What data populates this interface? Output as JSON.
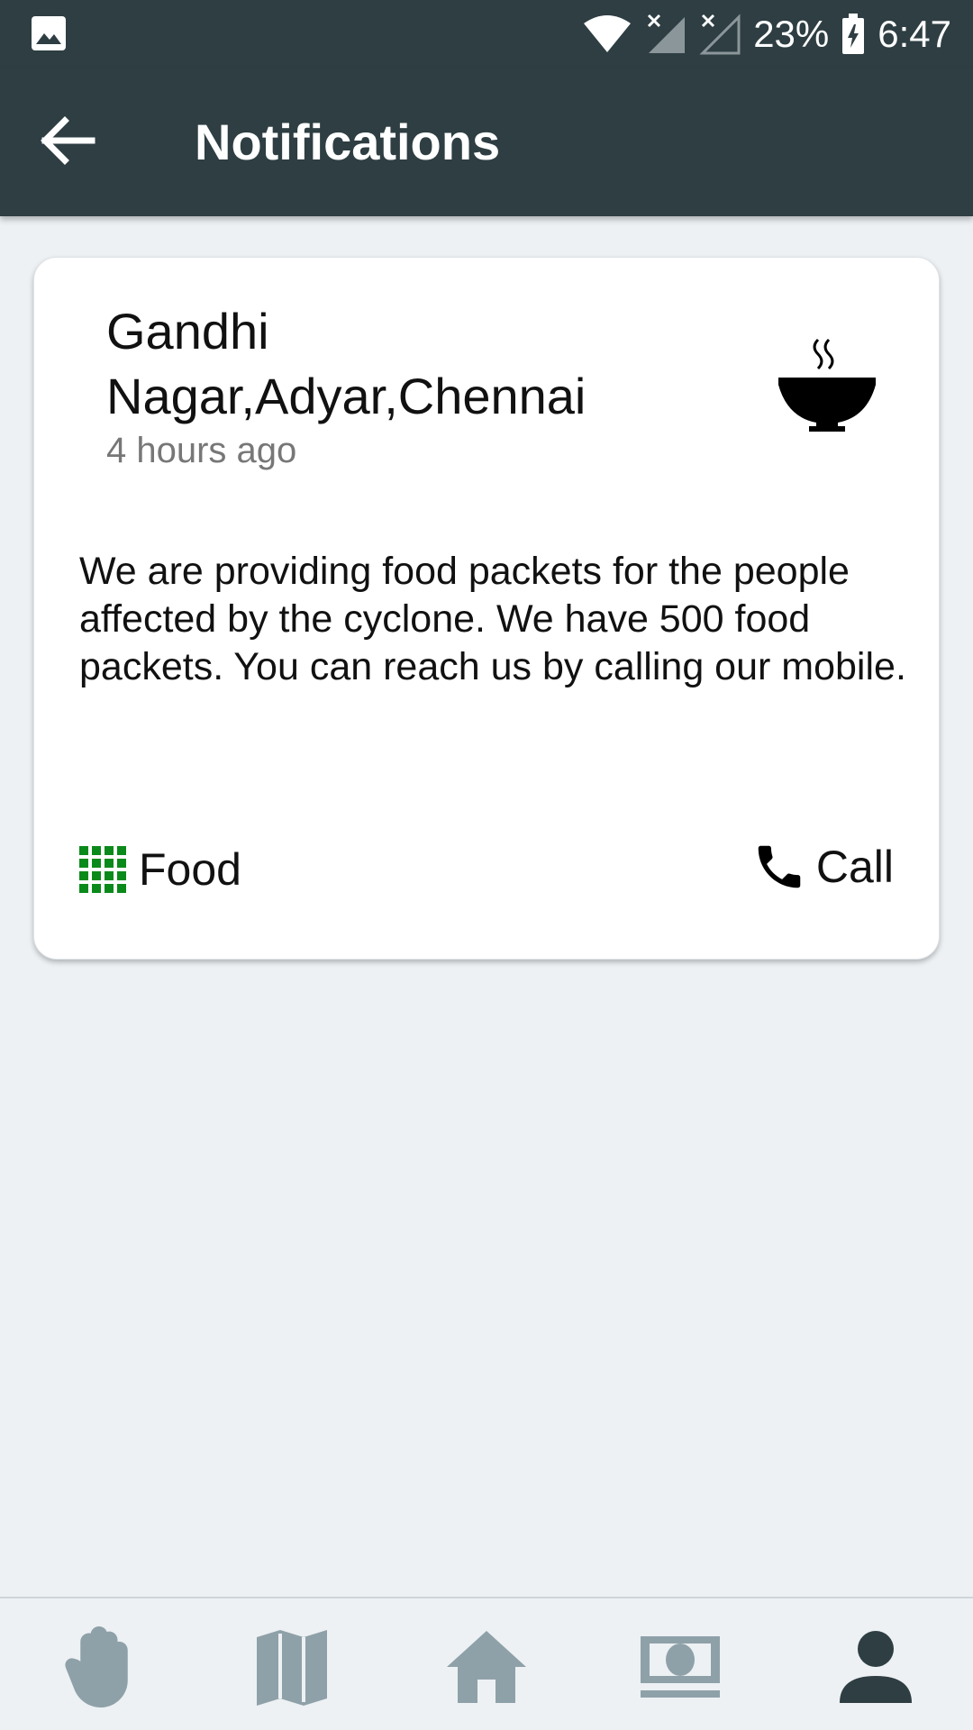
{
  "status_bar": {
    "battery": "23%",
    "time": "6:47"
  },
  "app_bar": {
    "title": "Notifications"
  },
  "notification": {
    "location": "Gandhi Nagar,Adyar,Chennai",
    "time_ago": "4 hours ago",
    "message": "We are providing food packets for the people affected by the cyclone. We have 500 food packets. You can reach us by calling our mobile.",
    "category_label": "Food",
    "call_label": "Call"
  },
  "colors": {
    "app_bar": "#2e3e43",
    "category_icon": "#0a8a1a",
    "nav_inactive": "#8fa1a8",
    "nav_active": "#2e3e43"
  },
  "bottom_nav": [
    {
      "icon": "hand-icon",
      "active": false
    },
    {
      "icon": "map-icon",
      "active": false
    },
    {
      "icon": "home-icon",
      "active": false
    },
    {
      "icon": "money-icon",
      "active": false
    },
    {
      "icon": "person-icon",
      "active": true
    }
  ]
}
